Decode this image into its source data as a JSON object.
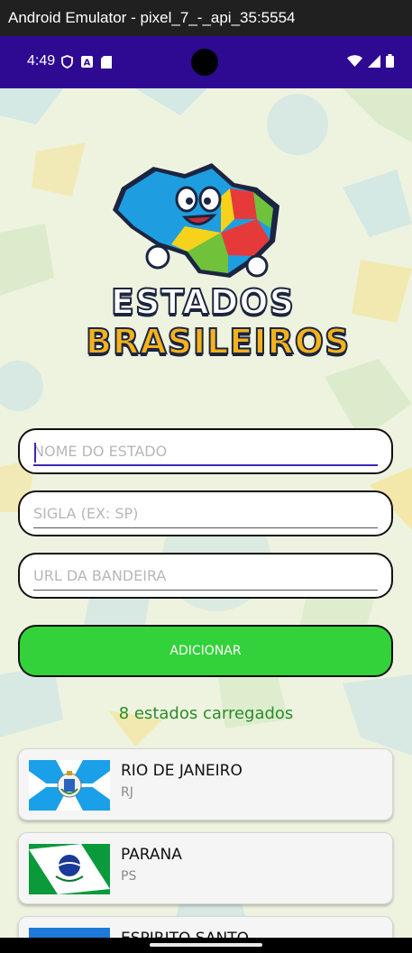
{
  "window": {
    "title": "Android Emulator - pixel_7_-_api_35:5554"
  },
  "statusbar": {
    "time": "4:49",
    "left_icons": [
      "shield-icon",
      "a-box-icon",
      "sd-card-icon"
    ],
    "right_icons": [
      "wifi-icon",
      "signal-icon",
      "battery-icon"
    ]
  },
  "logo": {
    "line1": "ESTADOS",
    "line2": "BRASILEIROS"
  },
  "form": {
    "nome_placeholder": "NOME DO ESTADO",
    "sigla_placeholder": "SIGLA (EX: SP)",
    "url_placeholder": "URL DA BANDEIRA",
    "add_label": "ADICIONAR"
  },
  "status_text": "8 estados carregados",
  "states": [
    {
      "name": "RIO DE JANEIRO",
      "abbr": "RJ"
    },
    {
      "name": "PARANA",
      "abbr": "PS"
    },
    {
      "name": "ESPIRITO SANTO",
      "abbr": ""
    }
  ],
  "colors": {
    "statusbar": "#2e0a93",
    "accent": "#3a2ab5",
    "button": "#33d13a",
    "count_text": "#2a8c2a"
  }
}
